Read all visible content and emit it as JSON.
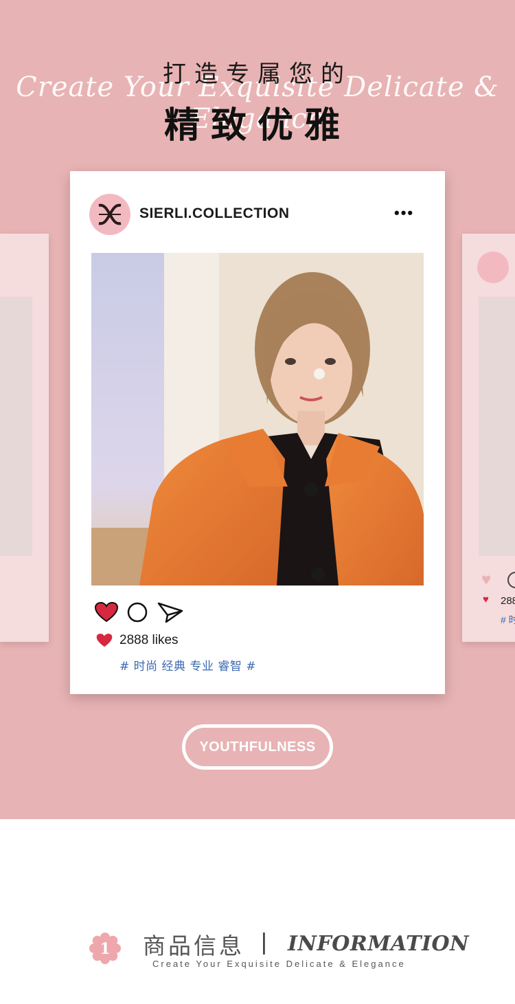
{
  "hero": {
    "headline_top": "打造专属您的",
    "script_line": "Create Your Exquisite Delicate & Elegance",
    "headline_main": "精致优雅",
    "background": "#e8b3b4"
  },
  "post": {
    "account": "SIERLI.COLLECTION",
    "more_icon": "•••",
    "likes": "2888 likes",
    "hashtags": "# 时尚 经典 专业 睿智 #",
    "icons": [
      "heart-icon",
      "comment-icon",
      "share-icon",
      "like-heart-icon"
    ]
  },
  "side_post": {
    "likes_short": "288",
    "tag_short": "# 时"
  },
  "cta": {
    "label": "YOUTHFULNESS"
  },
  "info": {
    "number": "1",
    "title_cn": "商品信息",
    "separator": "|",
    "title_en": "INFORMATION",
    "subtitle": "Create Your Exquisite Delicate & Elegance"
  },
  "colors": {
    "accent_pink": "#e8b3b4",
    "heart_red": "#d6283f",
    "hashtag_blue": "#3a68b0"
  }
}
